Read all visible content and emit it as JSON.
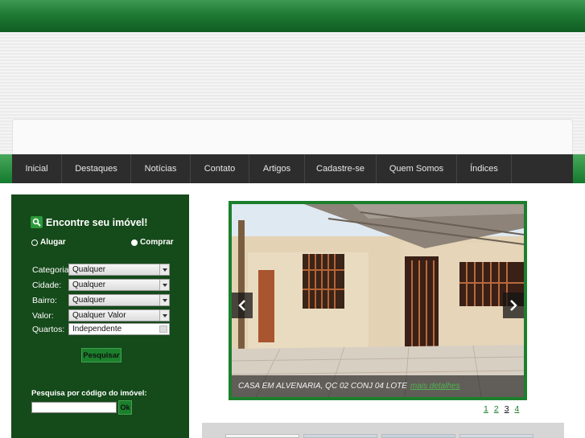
{
  "nav": {
    "items": [
      "Inicial",
      "Destaques",
      "Notícias",
      "Contato",
      "Artigos",
      "Cadastre-se",
      "Quem Somos",
      "Índices"
    ]
  },
  "search": {
    "title": "Encontre seu imóvel!",
    "option_rent": "Alugar",
    "option_buy": "Comprar",
    "selected_option": "Alugar",
    "fields": [
      {
        "label": "Categoria:",
        "value": "Qualquer"
      },
      {
        "label": "Cidade:",
        "value": "Qualquer"
      },
      {
        "label": "Bairro:",
        "value": "Qualquer"
      },
      {
        "label": "Valor:",
        "value": "Qualquer Valor"
      },
      {
        "label": "Quartos:",
        "value": "Independente"
      }
    ],
    "submit_label": "Pesquisar",
    "code_label": "Pesquisa por código do imóvel:",
    "code_value": "",
    "code_button": "Ok"
  },
  "featured": {
    "caption": "CASA EM ALVENARIA, QC 02 CONJ 04 LOTE",
    "more_link": "mais detalhes",
    "pages": [
      "1",
      "2",
      "3",
      "4"
    ],
    "active_page": "3"
  },
  "colors": {
    "brand_green": "#1c7f2c",
    "panel_green": "#154a1a",
    "navbar_bg": "#2d2d2d"
  }
}
